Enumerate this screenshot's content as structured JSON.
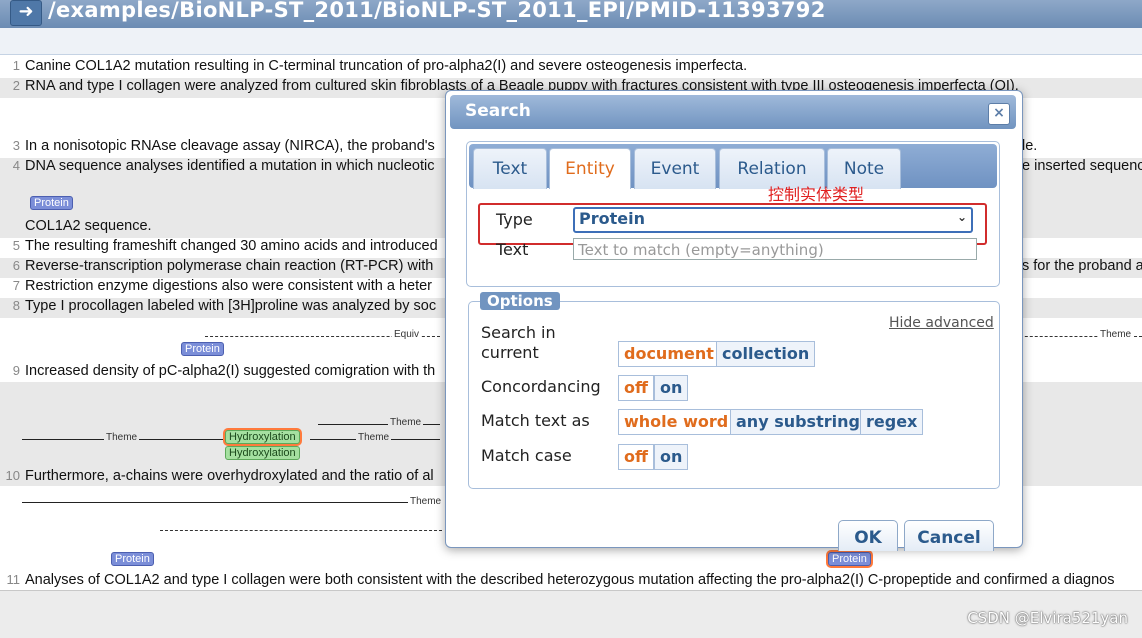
{
  "header": {
    "path": "/examples/BioNLP-ST_2011/BioNLP-ST_2011_EPI/PMID-11393792",
    "back_icon": "arrow-right-icon"
  },
  "lines": [
    {
      "num": "1",
      "text": "Canine COL1A2 mutation resulting in C-terminal truncation of pro-alpha2(I) and severe osteogenesis imperfecta."
    },
    {
      "num": "2",
      "text": "RNA and type I collagen were analyzed from cultured skin fibroblasts of a Beagle puppy with fractures consistent with type III osteogenesis imperfecta (OI)."
    },
    {
      "num": "3",
      "text": "In a nonisotopic RNAse cleavage assay (NIRCA), the proband's",
      "text_right": "le."
    },
    {
      "num": "4",
      "text": "DNA sequence analyses identified a mutation in which nucleotic",
      "text_right": "e inserted sequenc"
    },
    {
      "num": "",
      "text": "COL1A2 sequence."
    },
    {
      "num": "5",
      "text": "The resulting frameshift changed 30 amino acids and introduced"
    },
    {
      "num": "6",
      "text": "Reverse-transcription polymerase chain reaction (RT-PCR) with",
      "text_right": "s for the proband a"
    },
    {
      "num": "7",
      "text": "Restriction enzyme digestions also were consistent with a heter"
    },
    {
      "num": "8",
      "text": "Type I procollagen labeled with [3H]proline was analyzed by soc"
    },
    {
      "num": "9",
      "text": "Increased density of pC-alpha2(I) suggested comigration with th"
    },
    {
      "num": "10",
      "text": "Furthermore, a-chains were overhydroxylated and the ratio of al"
    },
    {
      "num": "11",
      "text": "Analyses of COL1A2 and type I collagen were both consistent with the described heterozygous mutation affecting the pro-alpha2(I) C-propeptide and confirmed a diagnos"
    }
  ],
  "annotations": {
    "protein": "Protein",
    "hydroxylation": "Hydroxylation",
    "theme": "Theme",
    "equiv": "Equiv"
  },
  "dialog": {
    "title": "Search",
    "close_icon": "close-icon",
    "tabs": [
      "Text",
      "Entity",
      "Event",
      "Relation",
      "Note"
    ],
    "active_tab": "Entity",
    "annotation_note": "控制实体类型",
    "type_label": "Type",
    "type_value": "Protein",
    "text_label": "Text",
    "text_placeholder": "Text to match (empty=anything)",
    "options_legend": "Options",
    "hide_advanced": "Hide advanced",
    "search_in_label": "Search in current",
    "search_in_options": [
      "document",
      "collection"
    ],
    "concordancing_label": "Concordancing",
    "concordancing_options": [
      "off",
      "on"
    ],
    "match_text_label": "Match text as",
    "match_text_options": [
      "whole word",
      "any substring",
      "regex"
    ],
    "match_case_label": "Match case",
    "match_case_options": [
      "off",
      "on"
    ],
    "ok_label": "OK",
    "cancel_label": "Cancel"
  },
  "watermark": "CSDN @Elvira521yan"
}
